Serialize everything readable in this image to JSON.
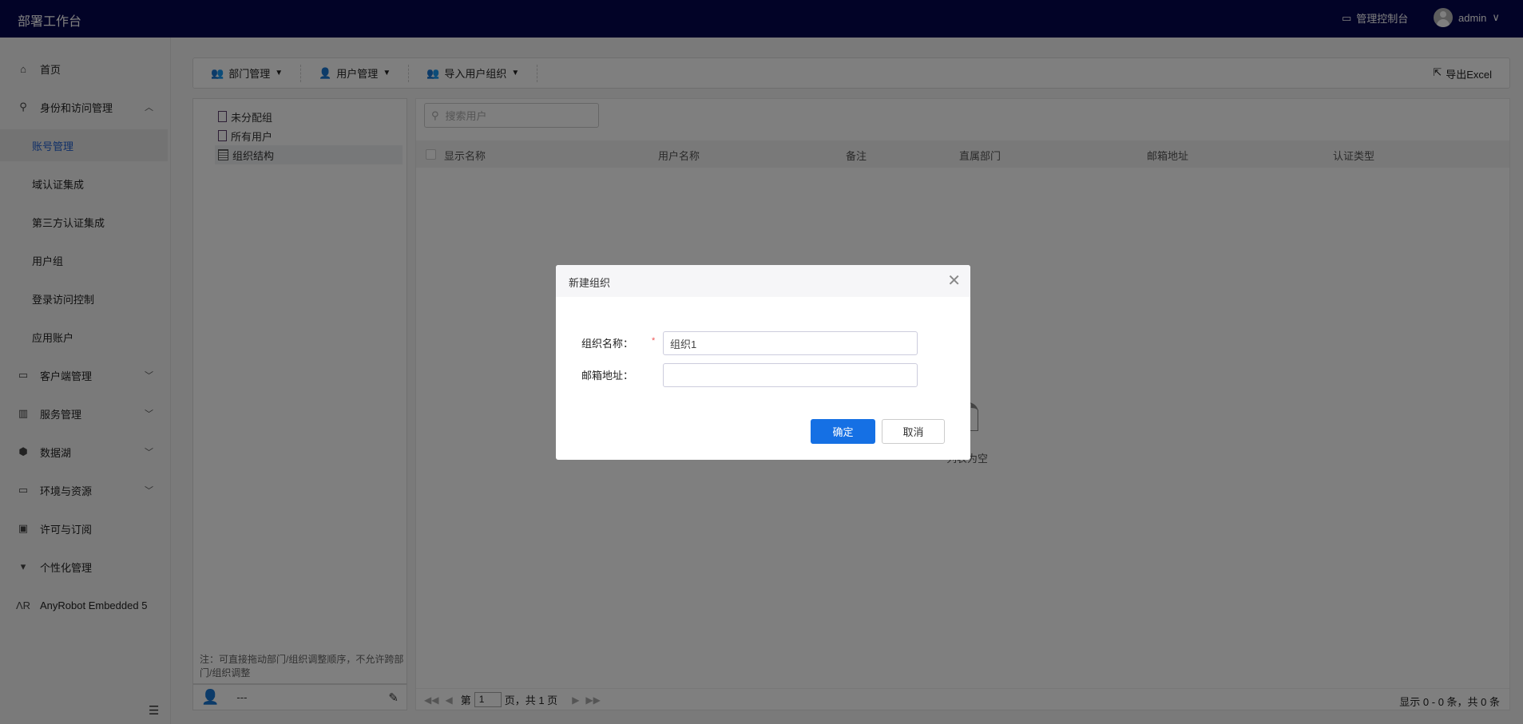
{
  "header": {
    "title": "部署工作台",
    "console_label": "管理控制台",
    "user": "admin"
  },
  "sidebar": {
    "items": [
      {
        "label": "首页",
        "icon": "home-icon"
      },
      {
        "label": "身份和访问管理",
        "icon": "org-icon",
        "expanded": true
      },
      {
        "label": "账号管理",
        "active": true
      },
      {
        "label": "域认证集成"
      },
      {
        "label": "第三方认证集成"
      },
      {
        "label": "用户组"
      },
      {
        "label": "登录访问控制"
      },
      {
        "label": "应用账户"
      },
      {
        "label": "客户端管理",
        "icon": "code-icon"
      },
      {
        "label": "服务管理",
        "icon": "layout-icon"
      },
      {
        "label": "数据湖",
        "icon": "hexagon-icon"
      },
      {
        "label": "环境与资源",
        "icon": "code-icon"
      },
      {
        "label": "许可与订阅",
        "icon": "license-icon"
      },
      {
        "label": "个性化管理",
        "icon": "shirt-icon"
      },
      {
        "label": "AnyRobot Embedded 5",
        "icon": "anyrobot-logo-icon"
      }
    ]
  },
  "toolbar": {
    "dept": "部门管理",
    "user": "用户管理",
    "import": "导入用户组织",
    "export": "导出Excel"
  },
  "tree": {
    "items": [
      "未分配组",
      "所有用户",
      "组织结构"
    ],
    "note": "注：可直接拖动部门/组织调整顺序，不允许跨部门/组织调整",
    "footer_name": "---"
  },
  "main": {
    "search_placeholder": "搜索用户",
    "columns": [
      "显示名称",
      "用户名称",
      "备注",
      "直属部门",
      "邮箱地址",
      "认证类型"
    ],
    "empty": "列表为空",
    "pager": {
      "prefix": "第",
      "page": "1",
      "suffix": "页，共 1 页",
      "total": "显示 0 - 0 条，共 0 条"
    }
  },
  "dialog": {
    "title": "新建组织",
    "name_label": "组织名称：",
    "name_value": "组织1",
    "email_label": "邮箱地址：",
    "email_value": "",
    "ok": "确定",
    "cancel": "取消"
  },
  "colors": {
    "topbar": "#05064f",
    "primary": "#1570e4",
    "active_nav": "#1f5fd1"
  }
}
